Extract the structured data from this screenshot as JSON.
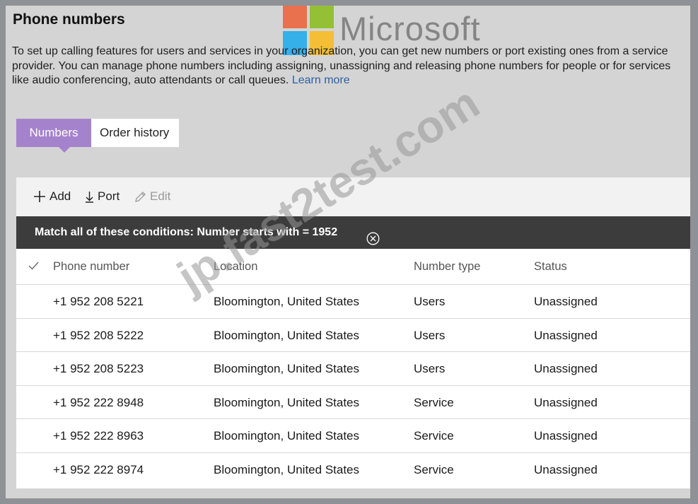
{
  "page": {
    "title": "Phone numbers",
    "description": "To set up calling features for users and services in your organization, you can get new numbers or port existing ones from a service provider. You can manage phone numbers including assigning, unassigning and releasing phone numbers for people or for services like audio conferencing, auto attendants or call queues.",
    "learn_more": "Learn more"
  },
  "watermark": {
    "brand": "Microsoft",
    "site": "jp.fast2test.com",
    "logo_colors": [
      "#f25022",
      "#7fba00",
      "#00a4ef",
      "#ffb900"
    ]
  },
  "tabs": [
    {
      "label": "Numbers",
      "active": true
    },
    {
      "label": "Order history",
      "active": false
    }
  ],
  "toolbar": {
    "add_label": "Add",
    "port_label": "Port",
    "edit_label": "Edit"
  },
  "filter": {
    "text": "Match all of these conditions: Number starts with = 1952"
  },
  "table": {
    "headers": {
      "number": "Phone number",
      "location": "Location",
      "type": "Number type",
      "status": "Status"
    },
    "rows": [
      {
        "number": "+1 952 208 5221",
        "location": "Bloomington, United States",
        "type": "Users",
        "status": "Unassigned"
      },
      {
        "number": "+1 952 208 5222",
        "location": "Bloomington, United States",
        "type": "Users",
        "status": "Unassigned"
      },
      {
        "number": "+1 952 208 5223",
        "location": "Bloomington, United States",
        "type": "Users",
        "status": "Unassigned"
      },
      {
        "number": "+1 952 222 8948",
        "location": "Bloomington, United States",
        "type": "Service",
        "status": "Unassigned"
      },
      {
        "number": "+1 952 222 8963",
        "location": "Bloomington, United States",
        "type": "Service",
        "status": "Unassigned"
      },
      {
        "number": "+1 952 222 8974",
        "location": "Bloomington, United States",
        "type": "Service",
        "status": "Unassigned"
      }
    ]
  },
  "colors": {
    "tab_active": "#a583cc",
    "filter_bar": "#3c3c3c",
    "link": "#2d5fa3"
  }
}
